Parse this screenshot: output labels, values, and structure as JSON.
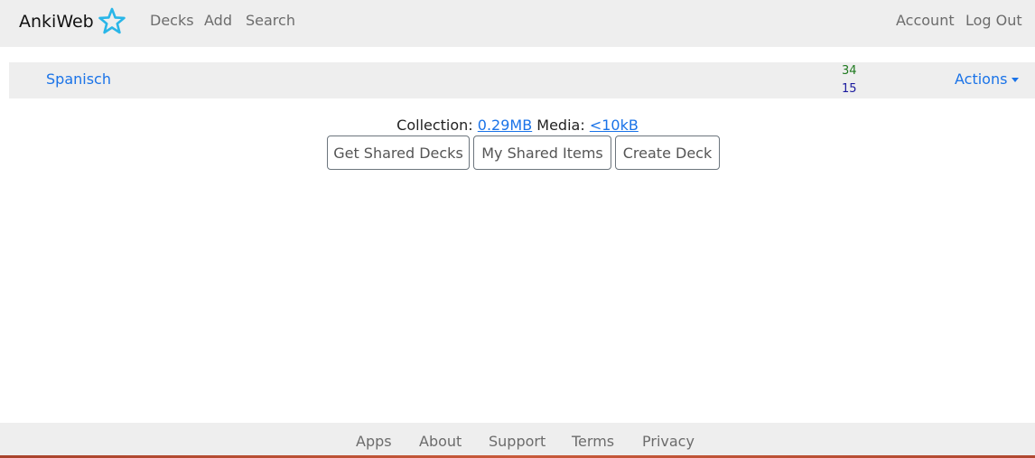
{
  "navbar": {
    "brand": "AnkiWeb",
    "links": [
      "Decks",
      "Add",
      "Search"
    ],
    "right_links": [
      "Account",
      "Log Out"
    ],
    "brand_icon": "star-outline-icon",
    "brand_icon_color": "#29b6e8"
  },
  "deck": {
    "name": "Spanisch",
    "due_count": "34",
    "new_count": "15",
    "actions_label": "Actions"
  },
  "collection": {
    "collection_label": "Collection:",
    "collection_size": "0.29MB",
    "media_label": "Media:",
    "media_size": "<10kB"
  },
  "buttons": {
    "get_shared": "Get Shared Decks",
    "my_shared": "My Shared Items",
    "create_deck": "Create Deck"
  },
  "footer": {
    "links": [
      "Apps",
      "About",
      "Support",
      "Terms",
      "Privacy"
    ]
  },
  "colors": {
    "link": "#1a73e8",
    "due": "#1f7a1f",
    "new": "#1a1a9e"
  }
}
